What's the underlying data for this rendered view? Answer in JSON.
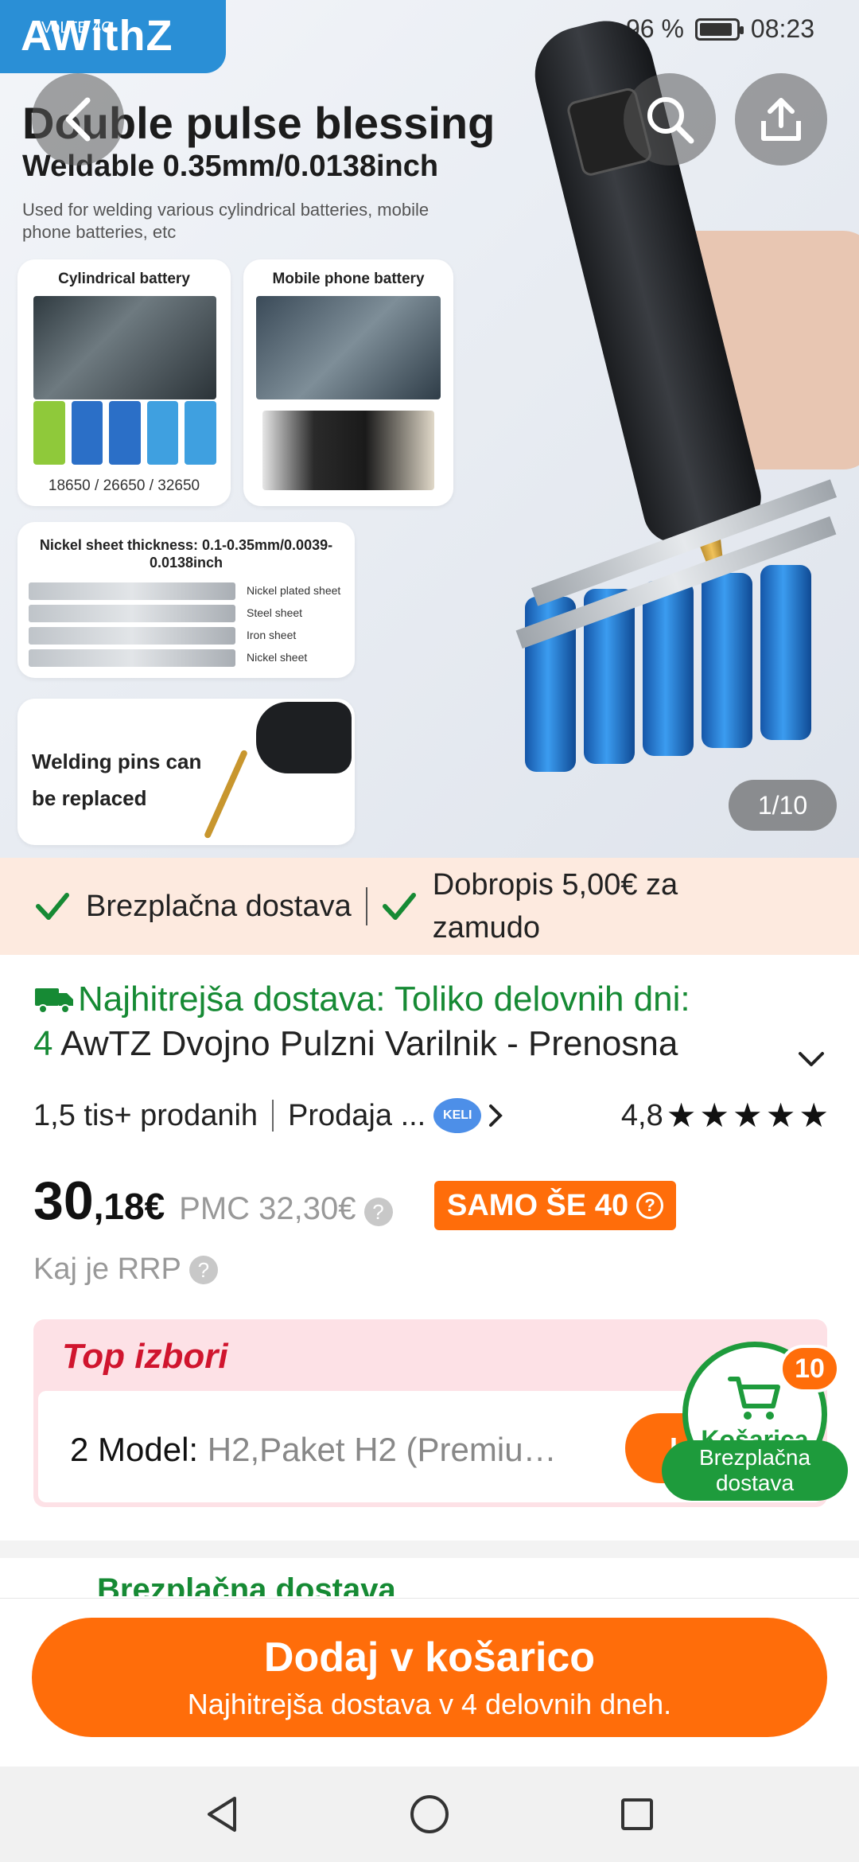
{
  "status": {
    "network": "VoLTE 4G",
    "battery": "96 %",
    "time": "08:23"
  },
  "hero": {
    "brand": "AWithZ",
    "title": "Double pulse blessing",
    "subtitle": "Weldable 0.35mm/0.0138inch",
    "description": "Used for welding various cylindrical batteries, mobile phone batteries, etc",
    "card_cylindrical": "Cylindrical battery",
    "card_cylindrical_sizes": "18650 / 26650 / 32650",
    "card_mobile": "Mobile phone battery",
    "nickel_title": "Nickel sheet thickness: 0.1-0.35mm/0.0039-0.0138inch",
    "nickel_labels": [
      "Nickel plated sheet",
      "Steel sheet",
      "Iron sheet",
      "Nickel sheet"
    ],
    "pins_text": "Welding pins can be replaced",
    "page_counter": "1/10"
  },
  "promo": {
    "item1": "Brezplačna dostava",
    "item2": "Dobropis 5,00€ za zamudo"
  },
  "product": {
    "fast_delivery": "Najhitrejša dostava: Toliko delovnih dni:",
    "days": "4",
    "title": "AwTZ Dvojno Pulzni Varilnik - Prenosna",
    "sold": "1,5 tis+ prodanih",
    "seller": "Prodaja ...",
    "seller_logo": "KELI",
    "rating": "4,8",
    "stars": 5,
    "price_int": "30",
    "price_dec": ",18€",
    "rrp": "PMC 32,30€",
    "stock": "SAMO ŠE 40",
    "rrp_link": "Kaj je RRP"
  },
  "picks": {
    "title": "Top izbori",
    "model_label": "2 Model:",
    "model_value": "H2,Paket H2 (Premiu…",
    "pill": "I"
  },
  "cart": {
    "label": "Košarica",
    "count": "10",
    "free": "Brezplačna dostava"
  },
  "shipping": {
    "label": "Brezplačna dostava"
  },
  "bottom": {
    "add_to_cart": "Dodaj v košarico",
    "sub": "Najhitrejša dostava v 4 delovnih dneh."
  },
  "colors": {
    "accent": "#ff6d0a",
    "green": "#168a34",
    "top_picks": "#d0152e"
  }
}
